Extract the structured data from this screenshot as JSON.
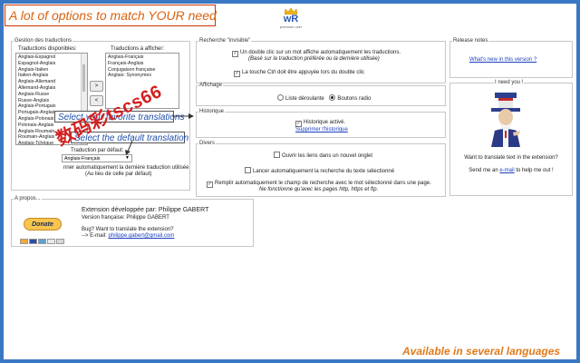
{
  "banner": {
    "text": "A lot of options to match YOUR need"
  },
  "logo": {
    "mark": "wR",
    "subtitle": "premium user"
  },
  "translations": {
    "legend": "Gestion des traductions",
    "available_label": "Traductions disponibles:",
    "selected_label": "Traductions à afficher:",
    "available_items": [
      "Anglais-Espagnol",
      "Espagnol-Anglais",
      "Anglais-Italien",
      "Italien-Anglais",
      "Anglais-Allemand",
      "Allemand-Anglais",
      "Anglais-Russe",
      "Russe-Anglais",
      "Anglais-Portugais",
      "Portugais-Anglais",
      "Anglais-Polonais",
      "Polonais-Anglais",
      "Anglais-Roumain",
      "Roumain-Anglais",
      "Anglais-Tchèque"
    ],
    "selected_items": [
      "Anglais-Français",
      "Français-Anglais",
      "Conjugaison française",
      "Anglais: Synonymes"
    ],
    "add_button": ">",
    "remove_button": "<",
    "default_label": "Traduction par défaut:",
    "default_value": "Anglais-Français",
    "remember_text": "nner automatiquement la dernière traduction utilisée",
    "remember_sub": "(Au lieu de celle par défaut)"
  },
  "callouts": {
    "select_favorites": "Select your favorite translations",
    "select_default": "Select the default translation"
  },
  "stamp_text": "数码彩tscs66",
  "recherche": {
    "legend": "Recherche \"invisible\"",
    "opt1_line1": "Un double clic sur un mot affiche automatiquement les traductions.",
    "opt1_line2": "(Basé sur la traduction préférée ou la dernière utilisée)",
    "opt2": "La touche Ctrl doit être appuyée lors du double clic"
  },
  "affichage": {
    "legend": "Affichage",
    "opt_dropdown": "Liste déroulante",
    "opt_radio": "Boutons radio"
  },
  "historique": {
    "legend": "Historique",
    "active": "Historique activé.",
    "delete_link": "Supprimer l'historique"
  },
  "divers": {
    "legend": "Divers",
    "opt1": "Ouvrir les liens dans un nouvel onglet",
    "opt2": "Lancer automatiquement la recherche du texte sélectionné",
    "opt3_line1": "Remplir automatiquement le champ de recherche avec le mot sélectionné dans une page.",
    "opt3_line2": "Ne fonctionne qu'avec les pages http, https et ftp."
  },
  "release": {
    "legend": "Release notes",
    "link": "What's new in this version ?"
  },
  "help": {
    "legend": "I need you !",
    "line1": "Want to translate text in the extension?",
    "line2_prefix": "Send me an ",
    "line2_link": "e-mail",
    "line2_suffix": " to help me out !"
  },
  "about": {
    "legend": "A propos...",
    "title": "Extension développée par: Philippe GABERT",
    "version": "Version française: Philippe GABERT",
    "bug": "Bug? Want to translate the extension?",
    "email_prefix": "--> E-mail: ",
    "email": "philippe.gabert@gmail.com",
    "donate": "Donate"
  },
  "footer": {
    "text": "Available in several languages"
  },
  "colors": {
    "background": "#3a78c4",
    "orange": "#e07b1a",
    "callout_blue": "#1f4faa",
    "stamp_red": "#d22020"
  }
}
